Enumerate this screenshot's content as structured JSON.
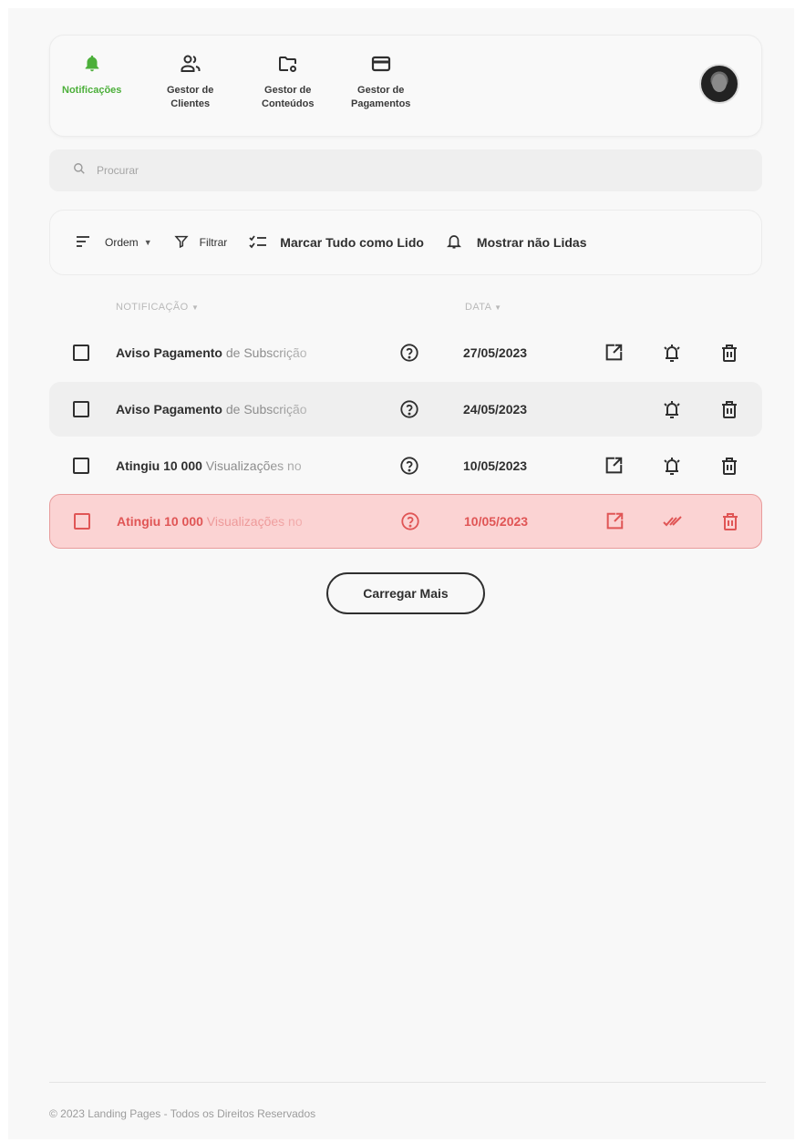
{
  "nav": {
    "items": [
      {
        "label": "Notificações",
        "icon": "bell-icon",
        "active": true
      },
      {
        "label": "Gestor de\nClientes",
        "icon": "users-icon",
        "active": false
      },
      {
        "label": "Gestor de\nConteúdos",
        "icon": "folder-settings-icon",
        "active": false
      },
      {
        "label": "Gestor de\nPagamentos",
        "icon": "credit-card-icon",
        "active": false
      }
    ],
    "accent_color": "#4caf3a"
  },
  "search": {
    "placeholder": "Procurar"
  },
  "toolbar": {
    "order_label": "Ordem",
    "filter_label": "Filtrar",
    "mark_all_label": "Marcar Tudo como Lido",
    "show_unread_label": "Mostrar não Lidas"
  },
  "table": {
    "headers": {
      "notification": "NOTIFICAÇÃO",
      "date": "DATA"
    },
    "rows": [
      {
        "title": "Aviso Pagamento",
        "title_muted": " de Subscrição",
        "date": "27/05/2023",
        "state": "normal",
        "has_open": true
      },
      {
        "title": "Aviso Pagamento",
        "title_muted": " de Subscrição",
        "date": "24/05/2023",
        "state": "hover",
        "has_open": false
      },
      {
        "title": "Atingiu 10 000",
        "title_muted": " Visualizações no",
        "date": "10/05/2023",
        "state": "normal",
        "has_open": true
      },
      {
        "title": "Atingiu 10 000",
        "title_muted": " Visualizações no",
        "date": "10/05/2023",
        "state": "alert",
        "has_open": true
      }
    ],
    "alert_color": "#e05555"
  },
  "load_more_label": "Carregar Mais",
  "footer": {
    "text": "© 2023 Landing Pages - Todos os Direitos Reservados"
  }
}
